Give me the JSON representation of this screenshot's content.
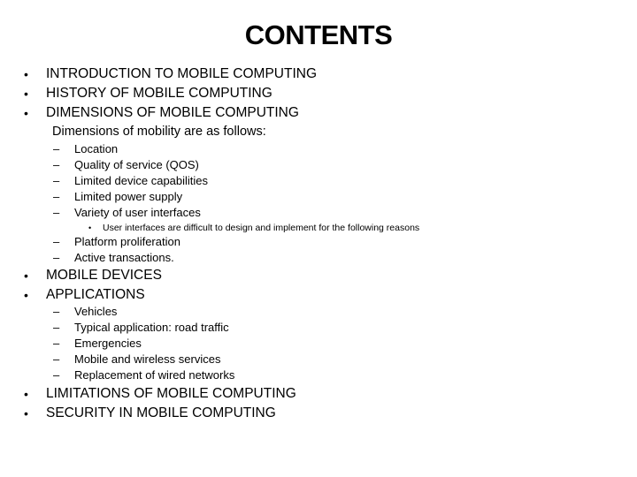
{
  "slide": {
    "title": "CONTENTS",
    "bullet_marker": "•",
    "dash_marker": "–",
    "items": [
      {
        "level": 1,
        "text": "INTRODUCTION TO MOBILE COMPUTING"
      },
      {
        "level": 1,
        "text": "HISTORY OF MOBILE COMPUTING"
      },
      {
        "level": 1,
        "text": "DIMENSIONS OF MOBILE COMPUTING"
      },
      {
        "level": 0,
        "text": "Dimensions of mobility are as follows:"
      },
      {
        "level": 2,
        "text": "Location"
      },
      {
        "level": 2,
        "text": "Quality of service (QOS)"
      },
      {
        "level": 2,
        "text": "Limited device capabilities"
      },
      {
        "level": 2,
        "text": "Limited power supply"
      },
      {
        "level": 2,
        "text": "Variety of user interfaces"
      },
      {
        "level": 3,
        "text": "User interfaces are difficult to design and implement for the following reasons"
      },
      {
        "level": 2,
        "text": "Platform proliferation"
      },
      {
        "level": 2,
        "text": "Active transactions."
      },
      {
        "level": 1,
        "text": "MOBILE DEVICES"
      },
      {
        "level": 1,
        "text": "APPLICATIONS"
      },
      {
        "level": 2,
        "text": "Vehicles"
      },
      {
        "level": 2,
        "text": "Typical application: road traffic"
      },
      {
        "level": 2,
        "text": "Emergencies"
      },
      {
        "level": 2,
        "text": "Mobile and wireless services"
      },
      {
        "level": 2,
        "text": "Replacement of wired networks"
      },
      {
        "level": 1,
        "text": "LIMITATIONS OF MOBILE COMPUTING"
      },
      {
        "level": 1,
        "text": "SECURITY IN MOBILE COMPUTING"
      }
    ]
  }
}
